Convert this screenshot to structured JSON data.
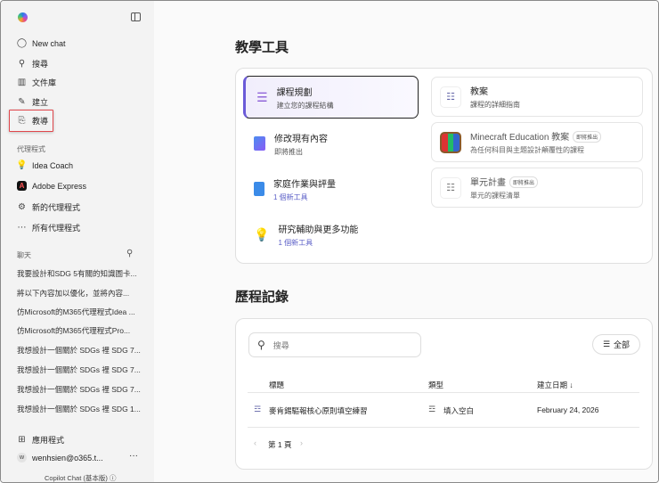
{
  "sidebar": {
    "nav": [
      {
        "label": "New chat",
        "icon": "chat-icon"
      },
      {
        "label": "搜尋",
        "icon": "search-icon"
      },
      {
        "label": "文件庫",
        "icon": "library-icon"
      },
      {
        "label": "建立",
        "icon": "create-icon"
      },
      {
        "label": "教導",
        "icon": "teach-icon"
      }
    ],
    "agents_label": "代理程式",
    "agents": [
      {
        "label": "Idea Coach"
      },
      {
        "label": "Adobe Express"
      },
      {
        "label": "新的代理程式"
      },
      {
        "label": "所有代理程式"
      }
    ],
    "chats_label": "聊天",
    "chats": [
      "我要設計和SDG 5有關的知識圖卡...",
      "將以下內容加以優化，並將內容...",
      "仿Microsoft的M365代理程式Idea ...",
      "仿Microsoft的M365代理程式Pro...",
      "我想設計一個關於 SDGs 裡 SDG 7...",
      "我想設計一個關於 SDGs 裡 SDG 7...",
      "我想設計一個關於 SDGs 裡 SDG 7...",
      "我想設計一個關於 SDGs 裡 SDG 1..."
    ],
    "apps": "應用程式",
    "user_initial": "w",
    "user": "wenhsien@o365.t...",
    "more": "···",
    "footer": "Copilot Chat (基本版)"
  },
  "tools": {
    "title": "教學工具",
    "left": [
      {
        "title": "課程規劃",
        "sub": "建立您的課程結構"
      },
      {
        "title": "修改現有內容",
        "sub": "即將推出"
      },
      {
        "title": "家庭作業與評量",
        "sub": "1 個新工具"
      },
      {
        "title": "研究輔助與更多功能",
        "sub": "1 個新工具"
      }
    ],
    "right": [
      {
        "title": "教案",
        "sub": "課程的詳細指南"
      },
      {
        "title": "Minecraft Education 教案",
        "badge": "即將推出",
        "sub": "為任何科目與主題設計顛覆性的課程"
      },
      {
        "title": "單元計畫",
        "badge": "即將推出",
        "sub": "單元的課程清單"
      }
    ]
  },
  "history": {
    "title": "歷程記錄",
    "search_placeholder": "搜尋",
    "filter": "全部",
    "columns": [
      "標題",
      "類型",
      "建立日期 ↓"
    ],
    "rows": [
      {
        "title": "麥肯錫驅報核心原則填空練習",
        "type": "填入空白",
        "date": "February 24, 2026"
      }
    ],
    "page": "第 1 頁"
  }
}
